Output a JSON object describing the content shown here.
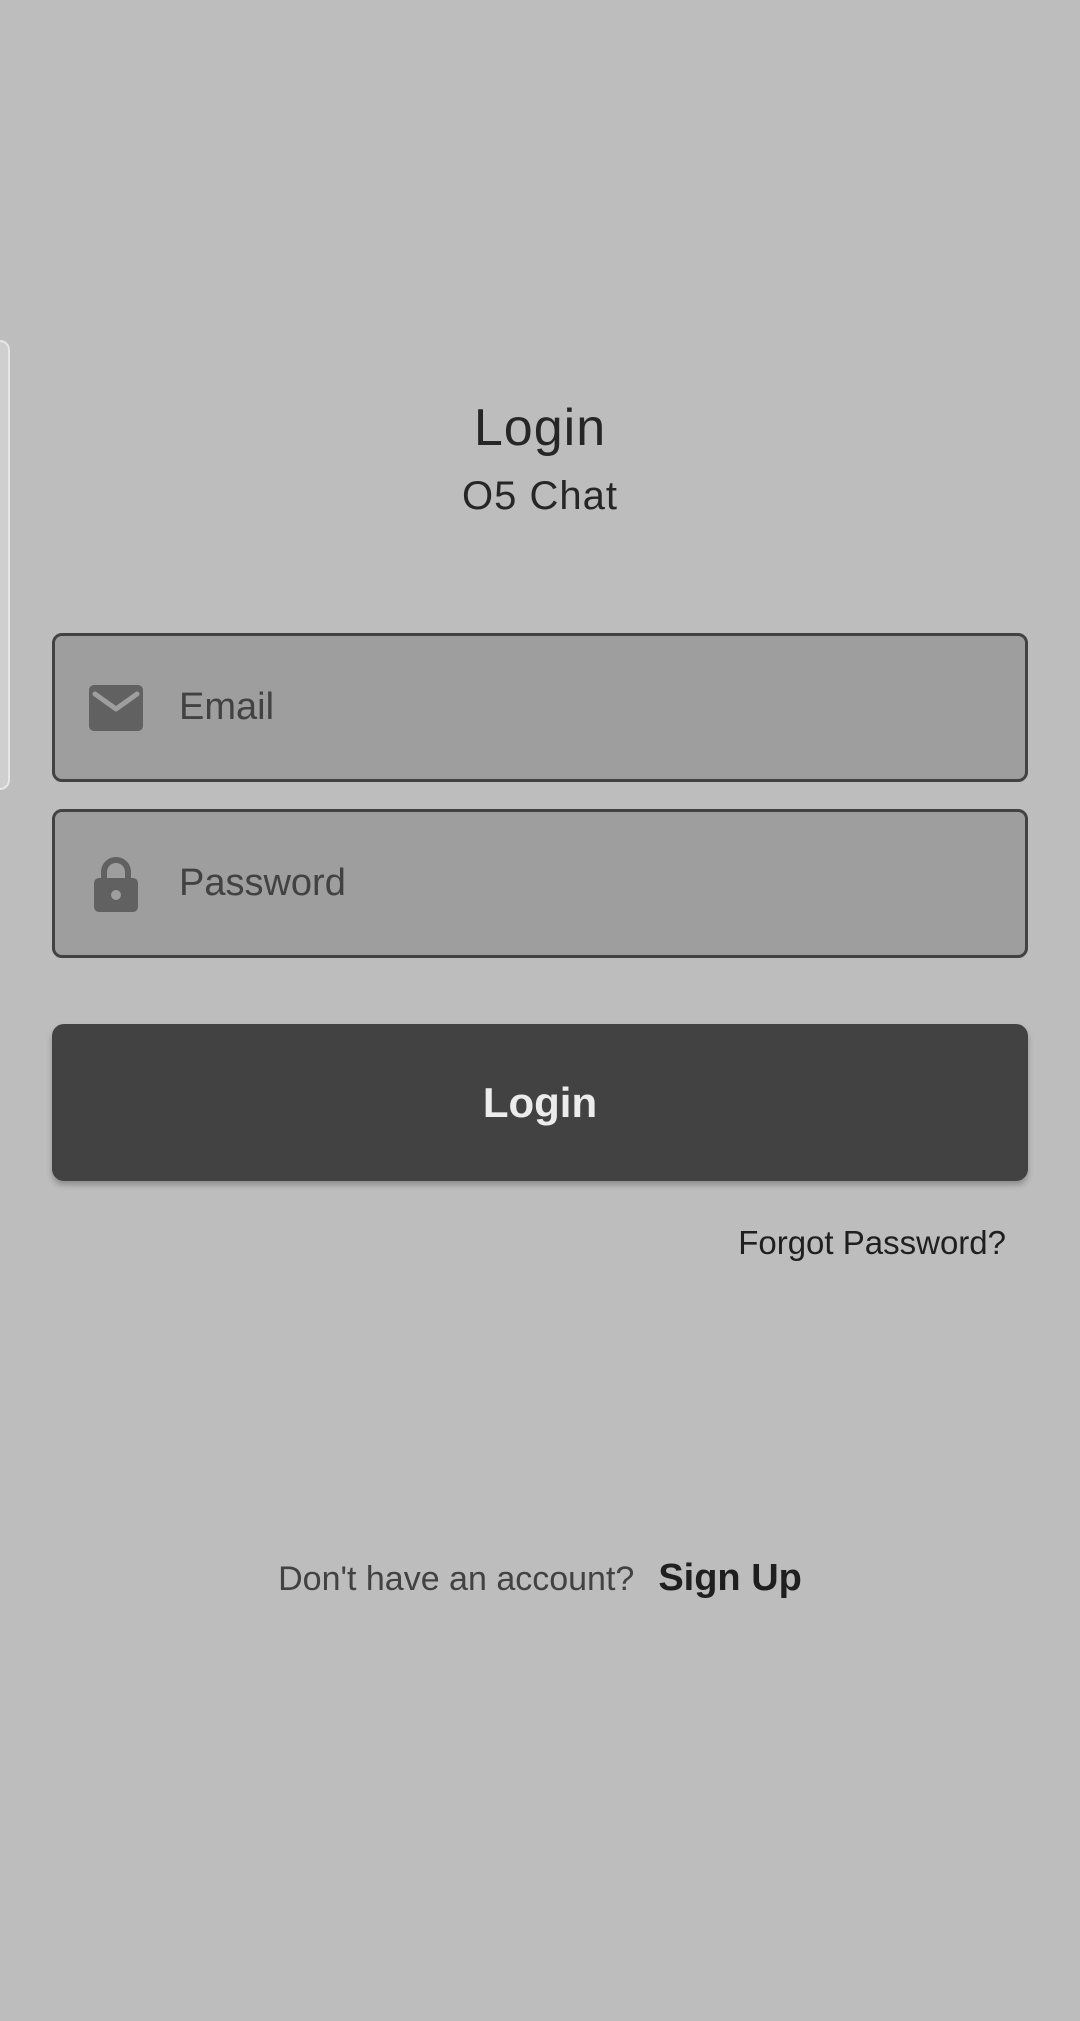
{
  "header": {
    "title": "Login",
    "subtitle": "O5 Chat"
  },
  "form": {
    "email": {
      "placeholder": "Email",
      "value": "",
      "icon": "mail-icon"
    },
    "password": {
      "placeholder": "Password",
      "value": "",
      "icon": "lock-icon"
    },
    "login_button": "Login",
    "forgot_password": "Forgot Password?"
  },
  "footer": {
    "prompt": "Don't have an account?",
    "signup": "Sign Up"
  },
  "colors": {
    "background": "#bdbdbd",
    "field_fill": "#9e9e9e",
    "button_fill": "#424242",
    "text_dark": "#262626"
  }
}
